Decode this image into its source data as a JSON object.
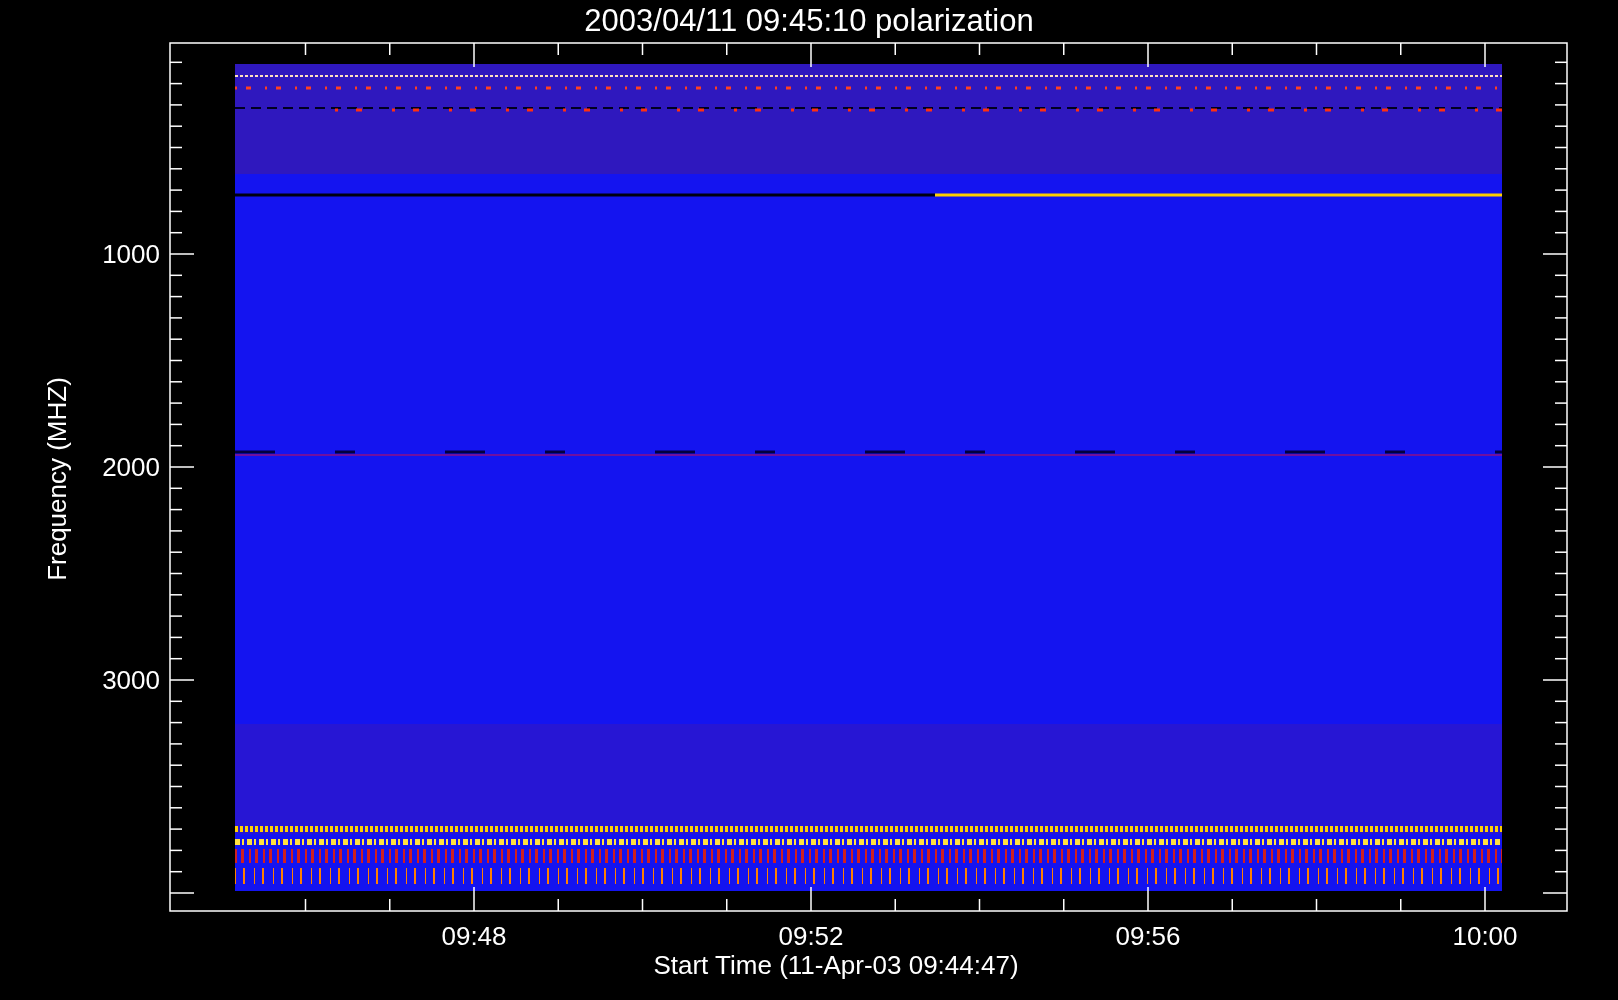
{
  "title": "2003/04/11 09:45:10 polarization",
  "y_axis": {
    "label": "Frequency (MHZ)",
    "ticks": [
      "1000",
      "2000",
      "3000"
    ]
  },
  "x_axis": {
    "label": "Start Time (11-Apr-03 09:44:47)",
    "ticks": [
      "09:48",
      "09:52",
      "09:56",
      "10:00"
    ]
  }
}
